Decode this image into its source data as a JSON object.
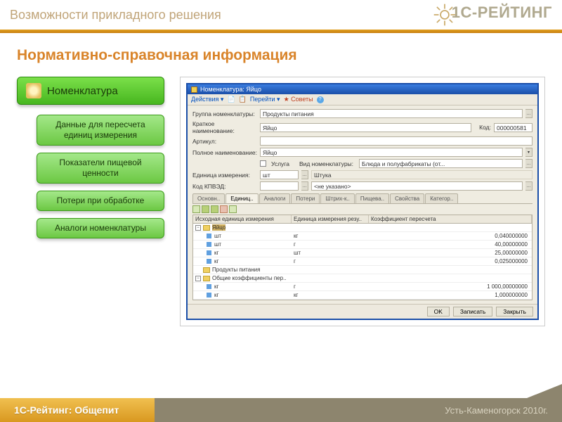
{
  "header": {
    "title": "Возможности прикладного решения",
    "brand": "1С-РЕЙТИНГ"
  },
  "page_title": "Нормативно-справочная информация",
  "sidebar": {
    "main": "Номенклатура",
    "items": [
      "Данные для пересчета единиц измерения",
      "Показатели пищевой ценности",
      "Потери при обработке",
      "Аналоги номенклатуры"
    ]
  },
  "window": {
    "title": "Номенклатура: Яйцо",
    "toolbar": {
      "actions": "Действия ▾",
      "go": "Перейти ▾",
      "tips": "Советы"
    },
    "fields": {
      "group_lbl": "Группа номенклатуры:",
      "group_val": "Продукты питания",
      "short_lbl": "Краткое наименование:",
      "short_val": "Яйцо",
      "code_lbl": "Код:",
      "code_val": "000000581",
      "art_lbl": "Артикул:",
      "full_lbl": "Полное наименование:",
      "full_val": "Яйцо",
      "service_lbl": "Услуга",
      "kind_lbl": "Вид номенклатуры:",
      "kind_val": "Блюда и полуфабрикаты (от...",
      "unit_lbl": "Единица измерения:",
      "unit_val": "шт",
      "unit2_val": "Штука",
      "kpved_lbl": "Код КПВЭД:",
      "kpved_val": "<не указано>"
    },
    "tabs": [
      "Основн..",
      "Единиц..",
      "Аналоги",
      "Потери",
      "Штрих-к..",
      "Пищева..",
      "Свойства",
      "Категор.."
    ],
    "grid": {
      "headers": [
        "Исходная единица измерения",
        "Единица измерения резу..",
        "Коэффициент пересчета"
      ],
      "rows": [
        {
          "type": "group-sel",
          "c1": "Яйцо",
          "c2": "",
          "c3": ""
        },
        {
          "type": "leaf",
          "c1": "шт",
          "c2": "кг",
          "c3": "0,040000000"
        },
        {
          "type": "leaf",
          "c1": "шт",
          "c2": "г",
          "c3": "40,00000000"
        },
        {
          "type": "leaf",
          "c1": "кг",
          "c2": "шт",
          "c3": "25,00000000"
        },
        {
          "type": "leaf",
          "c1": "кг",
          "c2": "г",
          "c3": "0,025000000"
        },
        {
          "type": "group",
          "c1": "Продукты питания",
          "c2": "",
          "c3": ""
        },
        {
          "type": "group",
          "c1": "Общие коэффициенты пер..",
          "c2": "",
          "c3": ""
        },
        {
          "type": "leaf",
          "c1": "кг",
          "c2": "г",
          "c3": "1 000,00000000"
        },
        {
          "type": "leaf",
          "c1": "кг",
          "c2": "кг",
          "c3": "1,000000000"
        }
      ]
    },
    "buttons": {
      "ok": "OK",
      "save": "Записать",
      "close": "Закрыть"
    }
  },
  "footer": {
    "left": "1С-Рейтинг: Общепит",
    "right": "Усть-Каменогорск 2010г."
  }
}
